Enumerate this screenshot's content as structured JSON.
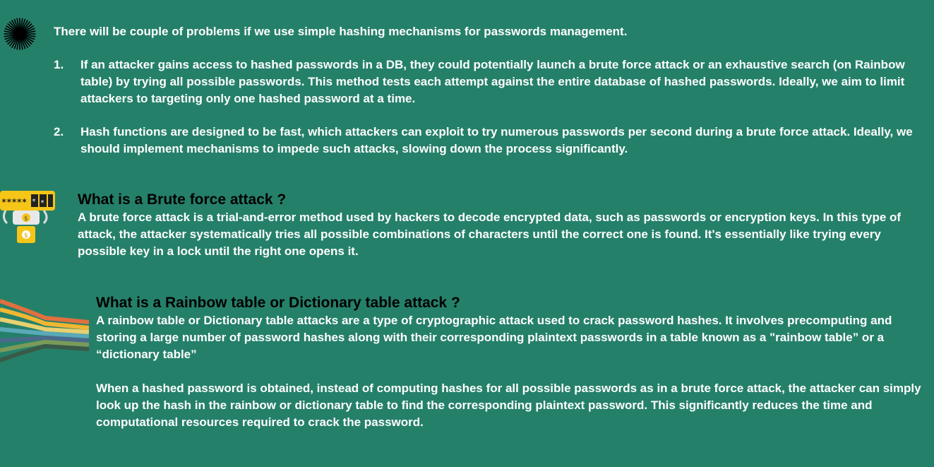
{
  "intro": "There will be couple of problems if we use simple hashing mechanisms for passwords management.",
  "problems": [
    {
      "number": "1.",
      "text": "If an attacker gains access to hashed passwords in a DB, they could potentially launch a brute force attack or an exhaustive search (on Rainbow table) by trying all possible passwords. This method tests each attempt against the entire database of hashed passwords. Ideally, we aim to limit attackers to targeting only one hashed password at a time."
    },
    {
      "number": "2.",
      "text": "Hash functions are designed to be fast, which attackers can exploit to try numerous passwords per second during a brute force attack. Ideally, we should implement mechanisms to impede such attacks, slowing down the process significantly."
    }
  ],
  "brute_force": {
    "title": "What is a Brute force attack ?",
    "text": "A brute force attack is a trial-and-error method used by hackers to decode encrypted data, such as passwords or encryption keys. In this type of attack, the attacker systematically tries all possible combinations of characters until the correct one is found. It's essentially like trying every possible key in a lock until the right one opens it."
  },
  "rainbow": {
    "title": "What is a Rainbow table or Dictionary table attack ?",
    "text1": "A rainbow table or Dictionary table attacks are a type of cryptographic attack used to crack password hashes. It involves precomputing and storing a large number of password hashes along with their corresponding plaintext passwords in a table known as a \"rainbow table” or a “dictionary table”",
    "text2": "When a hashed password is obtained, instead of computing hashes for all possible passwords as in a brute force attack, the attacker can simply look up the hash in the rainbow or dictionary table to find the corresponding plaintext password. This significantly reduces the time and computational resources required to crack the password."
  },
  "icons": {
    "burst": "sunburst-icon",
    "robot": "password-robot-icon",
    "rainbow": "rainbow-stripes-icon",
    "password_mask": "*****"
  },
  "colors": {
    "background": "#25806a",
    "text": "#ffffff",
    "heading": "#000000",
    "robot_yellow": "#f5c518"
  }
}
